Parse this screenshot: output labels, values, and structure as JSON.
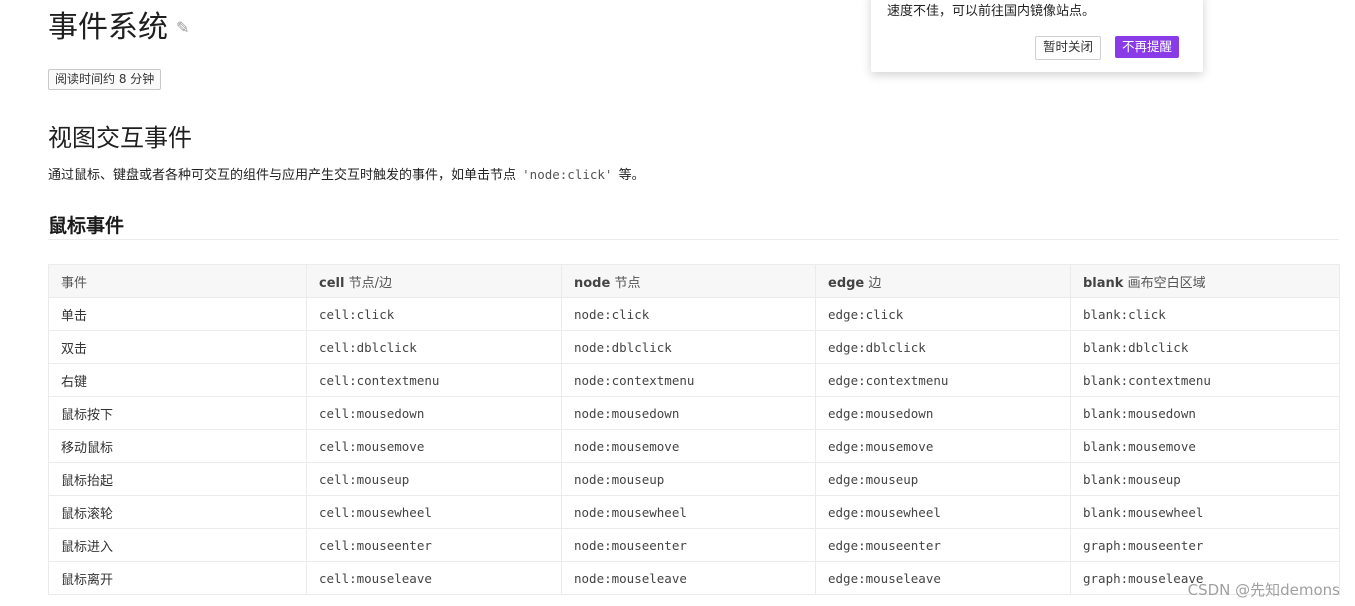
{
  "doc": {
    "title": "事件系统",
    "edit_icon": "pencil-icon",
    "reading_time": "阅读时间约 8 分钟",
    "section_title": "视图交互事件",
    "description_before": "通过鼠标、键盘或者各种可交互的组件与应用产生交互时触发的事件，如单击节点 ",
    "description_code": "'node:click'",
    "description_after": " 等。",
    "subsection_title": "鼠标事件"
  },
  "popup": {
    "message": "速度不佳，可以前往国内镜像站点。",
    "close_label": "暂时关闭",
    "never_label": "不再提醒"
  },
  "table": {
    "headers": [
      {
        "en": "",
        "zh": "事件"
      },
      {
        "en": "cell",
        "zh": " 节点/边"
      },
      {
        "en": "node",
        "zh": " 节点"
      },
      {
        "en": "edge",
        "zh": " 边"
      },
      {
        "en": "blank",
        "zh": " 画布空白区域"
      }
    ],
    "rows": [
      [
        "单击",
        "cell:click",
        "node:click",
        "edge:click",
        "blank:click"
      ],
      [
        "双击",
        "cell:dblclick",
        "node:dblclick",
        "edge:dblclick",
        "blank:dblclick"
      ],
      [
        "右键",
        "cell:contextmenu",
        "node:contextmenu",
        "edge:contextmenu",
        "blank:contextmenu"
      ],
      [
        "鼠标按下",
        "cell:mousedown",
        "node:mousedown",
        "edge:mousedown",
        "blank:mousedown"
      ],
      [
        "移动鼠标",
        "cell:mousemove",
        "node:mousemove",
        "edge:mousemove",
        "blank:mousemove"
      ],
      [
        "鼠标抬起",
        "cell:mouseup",
        "node:mouseup",
        "edge:mouseup",
        "blank:mouseup"
      ],
      [
        "鼠标滚轮",
        "cell:mousewheel",
        "node:mousewheel",
        "edge:mousewheel",
        "blank:mousewheel"
      ],
      [
        "鼠标进入",
        "cell:mouseenter",
        "node:mouseenter",
        "edge:mouseenter",
        "graph:mouseenter"
      ],
      [
        "鼠标离开",
        "cell:mouseleave",
        "node:mouseleave",
        "edge:mouseleave",
        "graph:mouseleave"
      ]
    ]
  },
  "watermark": "CSDN @先知demons"
}
